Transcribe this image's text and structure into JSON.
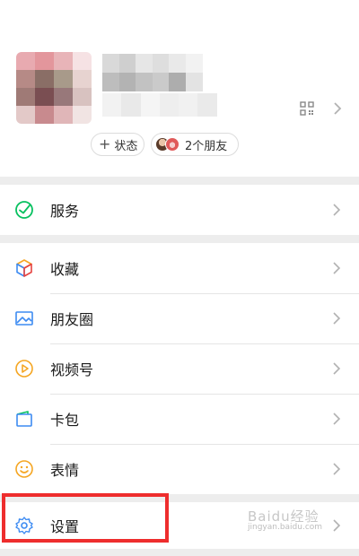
{
  "profile": {
    "status_button_label": "状态",
    "status_button_prefix": "+",
    "friends_label": "2个朋友"
  },
  "menu": {
    "service": {
      "label": "服务",
      "icon": "service-icon"
    },
    "favorites": {
      "label": "收藏",
      "icon": "favorites-cube-icon"
    },
    "moments": {
      "label": "朋友圈",
      "icon": "moments-image-icon"
    },
    "channels": {
      "label": "视频号",
      "icon": "channels-play-icon"
    },
    "cards": {
      "label": "卡包",
      "icon": "card-wallet-icon"
    },
    "stickers": {
      "label": "表情",
      "icon": "sticker-smile-icon"
    },
    "settings": {
      "label": "设置",
      "icon": "settings-gear-icon"
    }
  },
  "watermark": {
    "main": "Baidu经验",
    "sub": "jingyan.baidu.com"
  },
  "colors": {
    "service_green": "#07c160",
    "blue": "#3d8bf2",
    "orange": "#f5a623",
    "highlight_red": "#ee2d2d"
  }
}
